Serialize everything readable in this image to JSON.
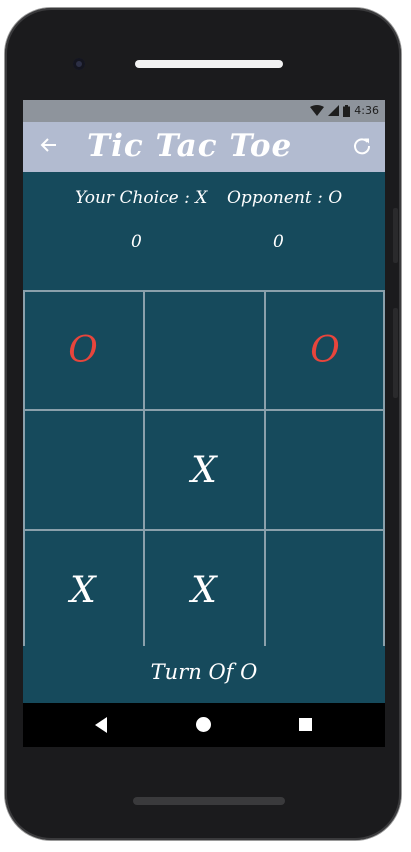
{
  "status_bar": {
    "time": "4:36",
    "icons": [
      "wifi-icon",
      "signal-icon",
      "battery-icon"
    ]
  },
  "app_bar": {
    "back_icon": "arrow-left-icon",
    "title": "Tic Tac Toe",
    "refresh_icon": "refresh-icon"
  },
  "scores": {
    "your_choice_label": "Your Choice : X",
    "opponent_label": "Opponent : O",
    "your_score": "0",
    "opponent_score": "0"
  },
  "board": {
    "cells": [
      {
        "value": "O"
      },
      {
        "value": ""
      },
      {
        "value": "O"
      },
      {
        "value": ""
      },
      {
        "value": "X"
      },
      {
        "value": ""
      },
      {
        "value": "X"
      },
      {
        "value": "X"
      },
      {
        "value": ""
      }
    ]
  },
  "turn_text": "Turn Of O",
  "nav": {
    "back_icon": "nav-back-icon",
    "home_icon": "nav-home-icon",
    "recent_icon": "nav-recent-icon"
  },
  "colors": {
    "background": "#164a5c",
    "app_bar": "#b2bbd0",
    "o_color": "#e8453c",
    "x_color": "#ffffff"
  }
}
